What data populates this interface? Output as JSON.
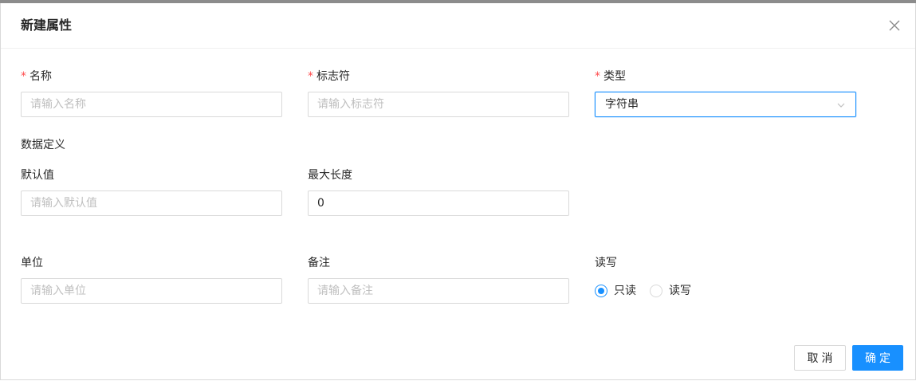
{
  "dialog": {
    "title": "新建属性"
  },
  "form": {
    "name": {
      "label": "名称",
      "required_mark": "*",
      "placeholder": "请输入名称",
      "value": ""
    },
    "identifier": {
      "label": "标志符",
      "required_mark": "*",
      "placeholder": "请输入标志符",
      "value": ""
    },
    "type": {
      "label": "类型",
      "required_mark": "*",
      "selected": "字符串"
    },
    "section_data_definition": "数据定义",
    "default_value": {
      "label": "默认值",
      "placeholder": "请输入默认值",
      "value": ""
    },
    "max_length": {
      "label": "最大长度",
      "placeholder": "",
      "value": "0"
    },
    "unit": {
      "label": "单位",
      "placeholder": "请输入单位",
      "value": ""
    },
    "remark": {
      "label": "备注",
      "placeholder": "请输入备注",
      "value": ""
    },
    "read_write": {
      "label": "读写",
      "options": [
        {
          "label": "只读",
          "checked": true
        },
        {
          "label": "读写",
          "checked": false
        }
      ]
    }
  },
  "footer": {
    "cancel_label": "取消",
    "ok_label": "确定"
  },
  "colors": {
    "primary": "#1890ff",
    "required": "#ff4d4f",
    "border": "#d9d9d9",
    "placeholder": "#bfbfbf"
  },
  "icons": {
    "close": "close-icon",
    "select_arrow": "chevron-down-icon"
  }
}
